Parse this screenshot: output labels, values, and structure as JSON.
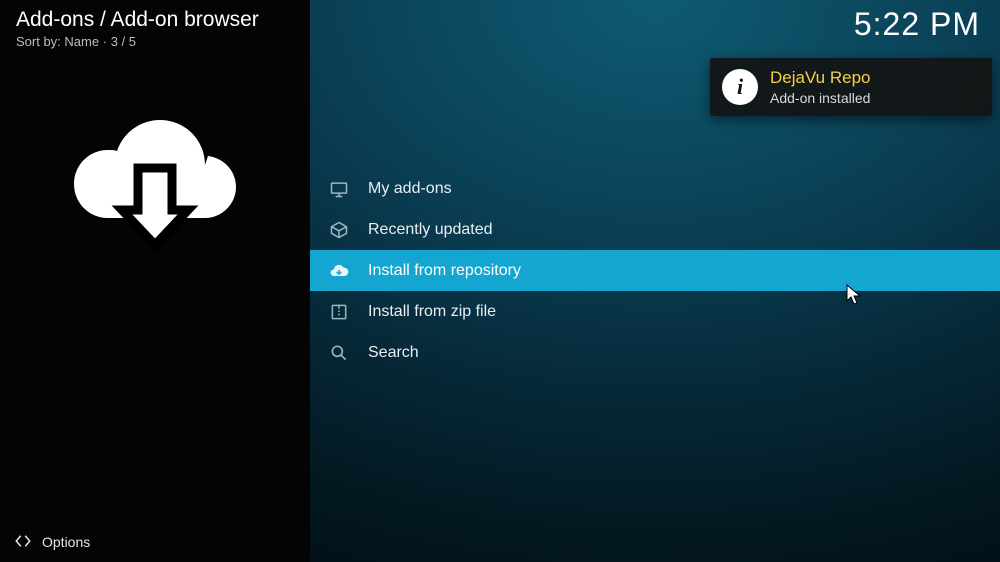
{
  "header": {
    "title": "Add-ons / Add-on browser",
    "sort_prefix": "Sort by:",
    "sort_value": "Name",
    "position": "3 / 5"
  },
  "clock": "5:22 PM",
  "menu": {
    "items": [
      {
        "id": "my-addons",
        "label": "My add-ons",
        "icon": "screen-icon"
      },
      {
        "id": "recently-updated",
        "label": "Recently updated",
        "icon": "box-icon"
      },
      {
        "id": "install-repo",
        "label": "Install from repository",
        "icon": "cloud-download-icon"
      },
      {
        "id": "install-zip",
        "label": "Install from zip file",
        "icon": "zip-icon"
      },
      {
        "id": "search",
        "label": "Search",
        "icon": "search-icon"
      }
    ],
    "selected_index": 2
  },
  "toast": {
    "title": "DejaVu Repo",
    "message": "Add-on installed"
  },
  "footer": {
    "options_label": "Options"
  }
}
